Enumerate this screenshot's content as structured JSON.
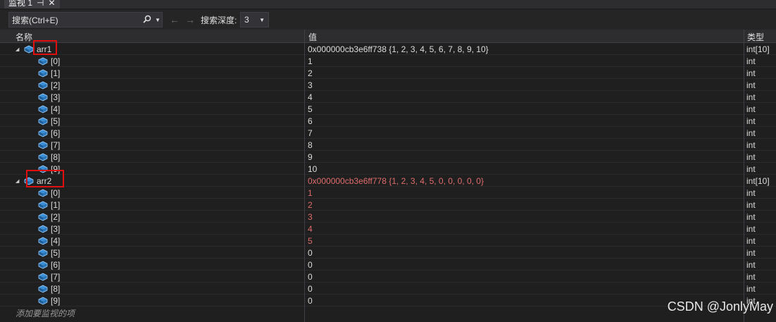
{
  "tab": {
    "title": "监视 1",
    "pin_glyph": "⊣",
    "close_glyph": "✕"
  },
  "toolbar": {
    "search_placeholder": "搜索(Ctrl+E)",
    "search_icon": "search-icon",
    "back_arrow": "←",
    "forward_arrow": "→",
    "depth_label": "搜索深度:",
    "depth_value": "3"
  },
  "columns": {
    "name": "名称",
    "value": "值",
    "type": "类型"
  },
  "arrays": [
    {
      "name": "arr1",
      "value": "0x000000cb3e6ff738 {1, 2, 3, 4, 5, 6, 7, 8, 9, 10}",
      "type": "int[10]",
      "value_changed": false,
      "elements": [
        {
          "index": "[0]",
          "value": "1",
          "type": "int",
          "changed": false
        },
        {
          "index": "[1]",
          "value": "2",
          "type": "int",
          "changed": false
        },
        {
          "index": "[2]",
          "value": "3",
          "type": "int",
          "changed": false
        },
        {
          "index": "[3]",
          "value": "4",
          "type": "int",
          "changed": false
        },
        {
          "index": "[4]",
          "value": "5",
          "type": "int",
          "changed": false
        },
        {
          "index": "[5]",
          "value": "6",
          "type": "int",
          "changed": false
        },
        {
          "index": "[6]",
          "value": "7",
          "type": "int",
          "changed": false
        },
        {
          "index": "[7]",
          "value": "8",
          "type": "int",
          "changed": false
        },
        {
          "index": "[8]",
          "value": "9",
          "type": "int",
          "changed": false
        },
        {
          "index": "[9]",
          "value": "10",
          "type": "int",
          "changed": false
        }
      ]
    },
    {
      "name": "arr2",
      "value": "0x000000cb3e6ff778 {1, 2, 3, 4, 5, 0, 0, 0, 0, 0}",
      "type": "int[10]",
      "value_changed": true,
      "elements": [
        {
          "index": "[0]",
          "value": "1",
          "type": "int",
          "changed": true
        },
        {
          "index": "[1]",
          "value": "2",
          "type": "int",
          "changed": true
        },
        {
          "index": "[2]",
          "value": "3",
          "type": "int",
          "changed": true
        },
        {
          "index": "[3]",
          "value": "4",
          "type": "int",
          "changed": true
        },
        {
          "index": "[4]",
          "value": "5",
          "type": "int",
          "changed": true
        },
        {
          "index": "[5]",
          "value": "0",
          "type": "int",
          "changed": false
        },
        {
          "index": "[6]",
          "value": "0",
          "type": "int",
          "changed": false
        },
        {
          "index": "[7]",
          "value": "0",
          "type": "int",
          "changed": false
        },
        {
          "index": "[8]",
          "value": "0",
          "type": "int",
          "changed": false
        },
        {
          "index": "[9]",
          "value": "0",
          "type": "int",
          "changed": false
        }
      ]
    }
  ],
  "add_watch_placeholder": "添加要监视的项",
  "watermark": "CSDN @JonlyMay",
  "colors": {
    "changed_value": "#e06c6c",
    "highlight_box": "#e01010",
    "background": "#1f1f1f"
  }
}
